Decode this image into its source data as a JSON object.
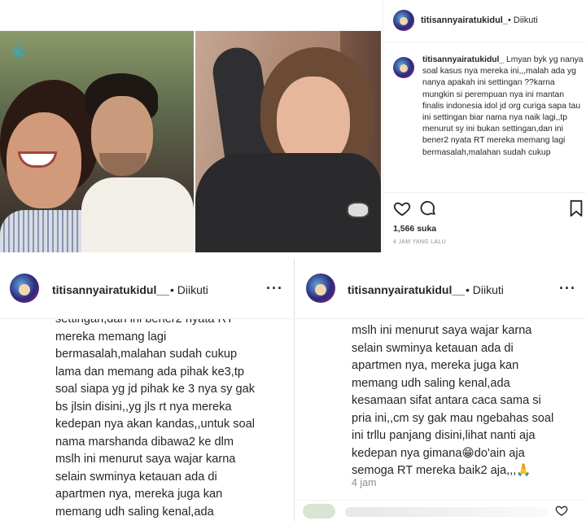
{
  "post": {
    "username": "titisannyairatukidul_",
    "follow_status": "• Diikuti",
    "caption_username": "titisannyairatukidul_",
    "caption_text": "Lmyan byk yg nanya soal kasus nya mereka ini,,,malah ada yg nanya apakah ini settingan ??karna mungkin si perempuan nya ini mantan finalis indonesia idol jd org curiga sapa tau ini settingan biar nama nya naik lagi,,tp menurut sy ini bukan settingan,dan ini bener2 nyata RT mereka memang lagi bermasalah,malahan sudah cukup",
    "likes": "1,566 suka",
    "time": "4 JAM YANG LALU"
  },
  "panel_a": {
    "username": "titisannyairatukidul__",
    "follow_status": "• Diikuti",
    "more": "···",
    "text": "settingan,dan ini bener2 nyata RT\nmereka memang lagi\nbermasalah,malahan sudah cukup\nlama dan memang ada pihak ke3,tp\nsoal siapa yg jd pihak ke 3 nya sy gak\nbs jlsin disini,,yg jls rt nya mereka\nkedepan nya akan kandas,,untuk soal\nnama marshanda dibawa2 ke dlm\nmslh ini menurut saya wajar karna\nselain swminya ketauan ada di\napartmen nya, mereka juga kan\nmemang udh saling kenal,ada\nkesamaan sifat antara caca sama si"
  },
  "panel_b": {
    "username": "titisannyairatukidul__",
    "follow_status": "• Diikuti",
    "more": "···",
    "text": "mslh ini menurut saya wajar karna\nselain swminya ketauan ada di\napartmen nya, mereka juga kan\nmemang udh saling kenal,ada\nkesamaan sifat antara caca sama si\npria ini,,cm sy gak mau ngebahas soal\nini trllu panjang disini,lihat nanti aja\nkedepan nya gimana😁do'ain aja\nsemoga RT mereka baik2 aja,,,🙏",
    "time": "4 jam"
  }
}
